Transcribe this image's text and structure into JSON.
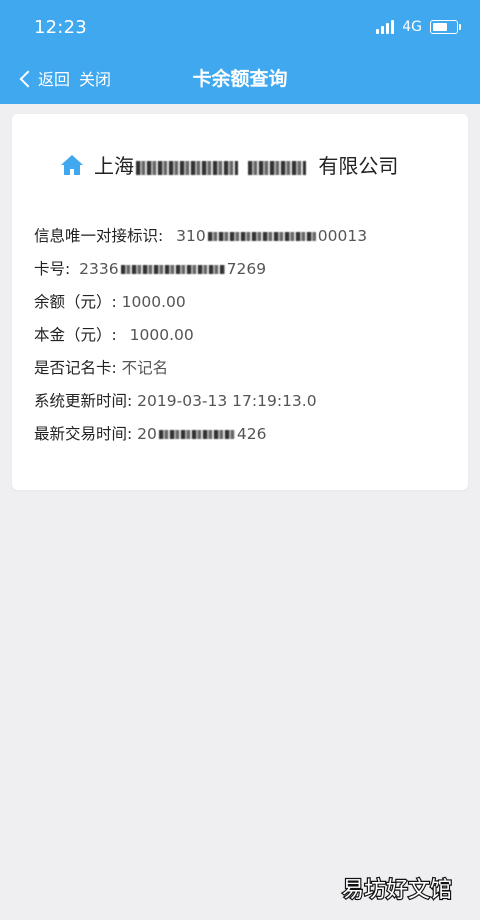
{
  "status_bar": {
    "time": "12:23",
    "network": "4G"
  },
  "nav": {
    "back_label": "返回",
    "close_label": "关闭",
    "title": "卡余额查询"
  },
  "card": {
    "company_prefix": "上海",
    "company_suffix": "有限公司",
    "rows": [
      {
        "label": "信息唯一对接标识:",
        "value_start": "310",
        "value_end": "00013",
        "redacted": true
      },
      {
        "label": "卡号:",
        "value_start": "2336",
        "value_end": "7269",
        "redacted": true
      },
      {
        "label": "余额（元）:",
        "value": "1000.00"
      },
      {
        "label": "本金（元）:",
        "value": "1000.00"
      },
      {
        "label": "是否记名卡:",
        "value": "不记名"
      },
      {
        "label": "系统更新时间:",
        "value": "2019-03-13 17:19:13.0"
      },
      {
        "label": "最新交易时间:",
        "value_start": "20",
        "value_end": "426",
        "redacted": true
      }
    ]
  },
  "watermark": "易坊好文馆",
  "colors": {
    "header_bg": "#3fa8ef",
    "page_bg": "#efeff2",
    "card_bg": "#ffffff",
    "icon_blue": "#3fa8ef"
  },
  "battery_level": 0.75
}
